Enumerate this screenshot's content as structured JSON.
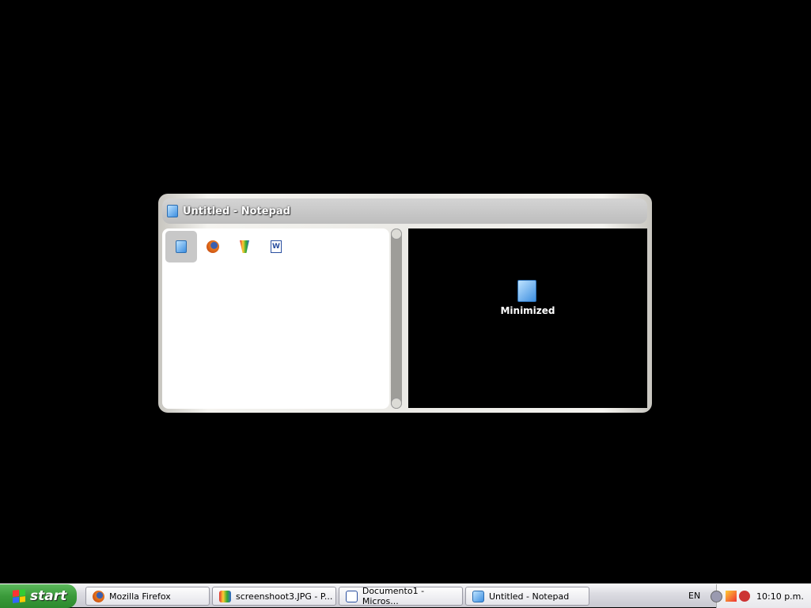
{
  "switcher": {
    "title": "Untitled - Notepad",
    "items": [
      {
        "icon": "notepad-icon",
        "selected": true
      },
      {
        "icon": "firefox-icon"
      },
      {
        "icon": "paint-icon"
      },
      {
        "icon": "word-icon"
      }
    ],
    "preview_label": "Minimized"
  },
  "taskbar": {
    "start_label": "start",
    "buttons": [
      {
        "label": "Mozilla Firefox",
        "icon": "firefox-icon"
      },
      {
        "label": "screenshoot3.JPG - P...",
        "icon": "paint-icon"
      },
      {
        "label": "Documento1 - Micros...",
        "icon": "word-icon"
      },
      {
        "label": "Untitled - Notepad",
        "icon": "notepad-icon"
      }
    ],
    "language": "EN",
    "clock": "10:10 p.m."
  },
  "colors": {
    "start": "#3a9a3a",
    "desktop": "#000000"
  }
}
